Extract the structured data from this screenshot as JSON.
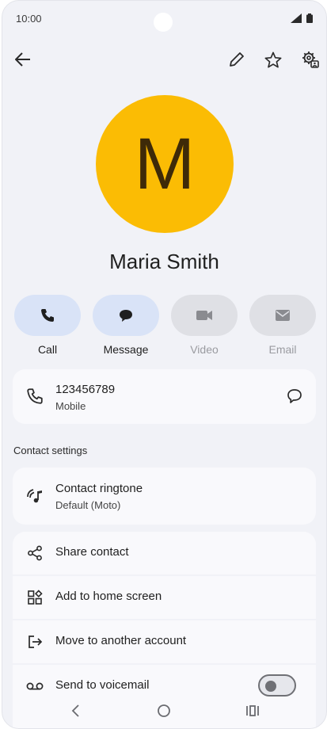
{
  "status_bar": {
    "time": "10:00"
  },
  "contact": {
    "initial": "M",
    "name": "Maria Smith",
    "avatar_color": "#fbbc04"
  },
  "actions": [
    {
      "label": "Call",
      "icon": "phone-icon",
      "enabled": true
    },
    {
      "label": "Message",
      "icon": "message-icon",
      "enabled": true
    },
    {
      "label": "Video",
      "icon": "video-icon",
      "enabled": false
    },
    {
      "label": "Email",
      "icon": "email-icon",
      "enabled": false
    }
  ],
  "phone_entry": {
    "number": "123456789",
    "type": "Mobile"
  },
  "contact_settings": {
    "heading": "Contact settings",
    "ringtone_title": "Contact ringtone",
    "ringtone_value": "Default (Moto)"
  },
  "list_items": [
    {
      "label": "Share contact",
      "icon": "share-icon"
    },
    {
      "label": "Add to home screen",
      "icon": "widgets-icon"
    },
    {
      "label": "Move to another account",
      "icon": "move-icon"
    },
    {
      "label": "Send to voicemail",
      "icon": "voicemail-icon",
      "toggle": false
    }
  ],
  "colors": {
    "accent_pill": "#d9e3f7",
    "background": "#f1f2f7",
    "card": "#f9f9fc"
  }
}
